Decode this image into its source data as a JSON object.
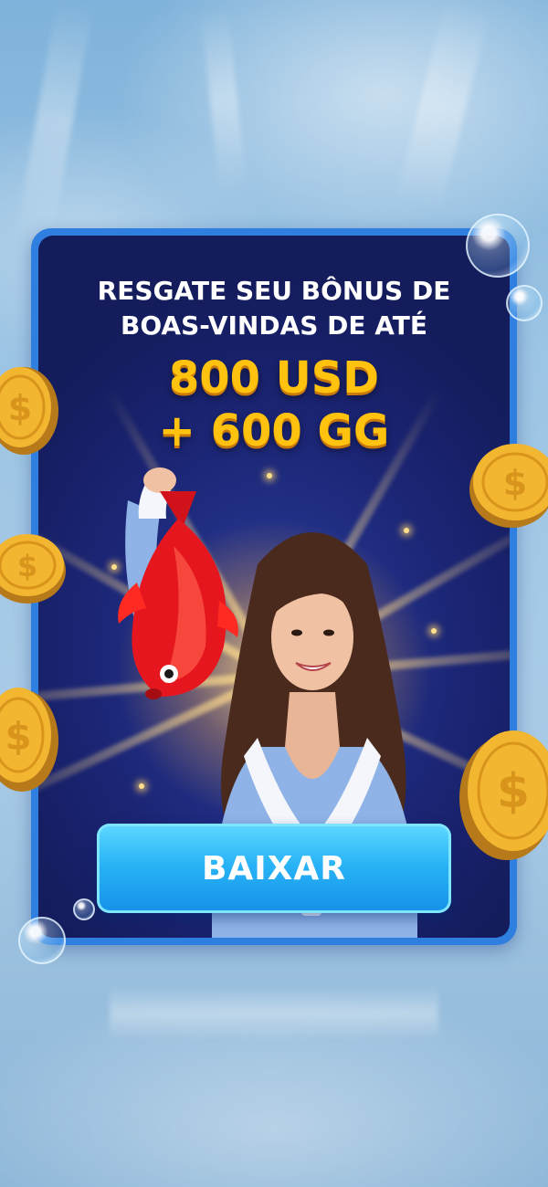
{
  "promo": {
    "headline_line1": "RESGATE SEU BÔNUS DE",
    "headline_line2": "BOAS-VINDAS DE ATÉ",
    "amount_usd": "800 USD",
    "amount_gg": "+ 600 GG"
  },
  "cta": {
    "label": "BAIXAR"
  },
  "colors": {
    "card_border": "#2f7fe0",
    "card_background": "#1b2574",
    "amount_text": "#ffc20e",
    "button": "#29b4f6"
  },
  "icons": [
    "dollar-coin-icon",
    "bubble-icon",
    "fish-icon"
  ]
}
